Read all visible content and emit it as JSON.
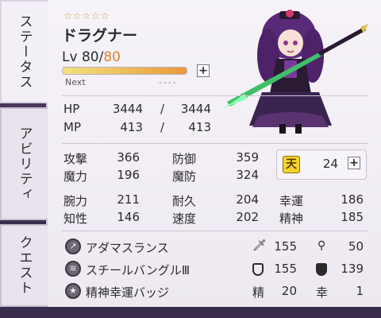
{
  "tabs": {
    "status": "ステータス",
    "ability": "アビリティ",
    "quest": "クエスト"
  },
  "unit": {
    "stars": "☆☆☆☆☆",
    "name": "ドラグナー",
    "level_prefix": "Lv",
    "level_current": "80",
    "level_sep": "/",
    "level_max": "80",
    "exp_progress": 1.0,
    "next_label": "Next",
    "next_value": "----"
  },
  "hp": {
    "label": "HP",
    "current": "3444",
    "sep": "/",
    "max": "3444"
  },
  "mp": {
    "label": "MP",
    "current": "413",
    "sep": "/",
    "max": "413"
  },
  "stats1": [
    {
      "label": "攻撃",
      "value": "366"
    },
    {
      "label": "防御",
      "value": "359"
    },
    {
      "label": "魔力",
      "value": "196"
    },
    {
      "label": "魔防",
      "value": "324"
    }
  ],
  "ten": {
    "icon": "天",
    "value": "24"
  },
  "stats2": [
    {
      "label": "腕力",
      "value": "211"
    },
    {
      "label": "耐久",
      "value": "204"
    },
    {
      "label": "幸運",
      "value": "186"
    },
    {
      "label": "知性",
      "value": "146"
    },
    {
      "label": "速度",
      "value": "202"
    },
    {
      "label": "精神",
      "value": "185"
    }
  ],
  "equipment": [
    {
      "name": "アダマスランス",
      "icon": "lance-icon",
      "stat_a_icon": "sword-icon",
      "stat_a": "155",
      "stat_b_icon": "staff-icon",
      "stat_b": "50"
    },
    {
      "name": "スチールバングルⅢ",
      "icon": "bangle-icon",
      "stat_a_icon": "shield-icon",
      "stat_a": "155",
      "stat_b_icon": "magic-shield-icon",
      "stat_b": "139"
    },
    {
      "name": "精神幸運バッジ",
      "icon": "badge-icon",
      "stat_a_label": "精",
      "stat_a": "20",
      "stat_b_label": "幸",
      "stat_b": "1"
    }
  ],
  "colors": {
    "level_max": "#d9842a",
    "star": "#c9a646",
    "ten_badge": "#f4d42a"
  }
}
